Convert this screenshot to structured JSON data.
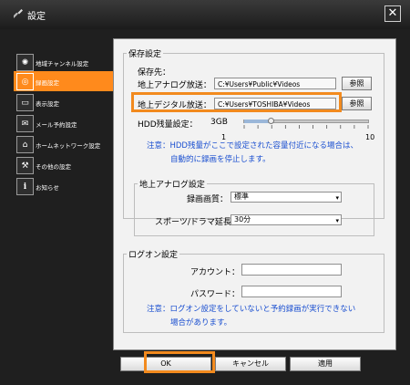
{
  "window": {
    "title": "設定",
    "close_glyph": "✕"
  },
  "sidebar": {
    "items": [
      {
        "label": "地域チャンネル設定",
        "icon": "antenna-icon",
        "glyph": "✺"
      },
      {
        "label": "録画設定",
        "icon": "record-icon",
        "glyph": "◎",
        "active": true
      },
      {
        "label": "表示設定",
        "icon": "display-icon",
        "glyph": "▭"
      },
      {
        "label": "メール予約設定",
        "icon": "mail-icon",
        "glyph": "✉"
      },
      {
        "label": "ホームネットワーク設定",
        "icon": "network-icon",
        "glyph": "⌂"
      },
      {
        "label": "その他の設定",
        "icon": "wrench-icon",
        "glyph": "⚒"
      },
      {
        "label": "お知らせ",
        "icon": "info-icon",
        "glyph": "i"
      }
    ]
  },
  "storage": {
    "group_title": "保存設定",
    "dest_label": "保存先：",
    "analog_label": "地上アナログ放送：",
    "analog_path": "C:¥Users¥Public¥Videos",
    "digital_label": "地上デジタル放送：",
    "digital_path": "C:¥Users¥TOSHIBA¥Videos",
    "browse_label": "参照",
    "hdd_label": "HDD残量設定：",
    "hdd_value": "3GB",
    "hdd_level": 3,
    "slider_min": "1",
    "slider_max": "10",
    "note_line1": "注意：HDD残量がここで設定された容量付近になる場合は、",
    "note_line2": "自動的に録画を停止します。"
  },
  "analog_settings": {
    "group_title": "地上アナログ設定",
    "quality_label": "録画画質：",
    "quality_value": "標準",
    "extend_label": "スポーツ/ドラマ延長：",
    "extend_value": "30分"
  },
  "logon": {
    "group_title": "ログオン設定",
    "account_label": "アカウント：",
    "account_value": "",
    "password_label": "パスワード：",
    "password_value": "",
    "note_line1": "注意：ログオン設定をしていないと予約録画が実行できない",
    "note_line2": "場合があります。"
  },
  "buttons": {
    "ok": "OK",
    "cancel": "キャンセル",
    "apply": "適用"
  },
  "colors": {
    "accent": "#ff8a1c",
    "note": "#1a4fd0",
    "window_bg": "#1f1f1f"
  }
}
